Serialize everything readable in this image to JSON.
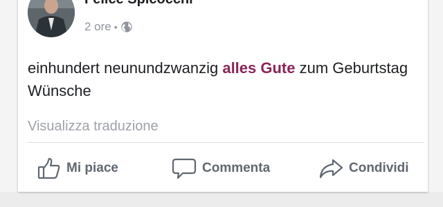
{
  "post": {
    "author": "Felice Spicocchi",
    "time": "2 ore",
    "separator": "•",
    "privacy_icon": "globe-icon",
    "more_icon": "more-options-icon",
    "more_glyph": "···",
    "text_before": "einhundert neunundzwanzig ",
    "text_highlight": "alles Gute",
    "text_after": " zum Geburtstag Wünsche",
    "highlight_color": "#8a2458",
    "translate_link": "Visualizza traduzione"
  },
  "actions": {
    "like": {
      "label": "Mi piace",
      "icon": "thumbs-up-icon"
    },
    "comment": {
      "label": "Commenta",
      "icon": "comment-icon"
    },
    "share": {
      "label": "Condividi",
      "icon": "share-icon"
    }
  }
}
